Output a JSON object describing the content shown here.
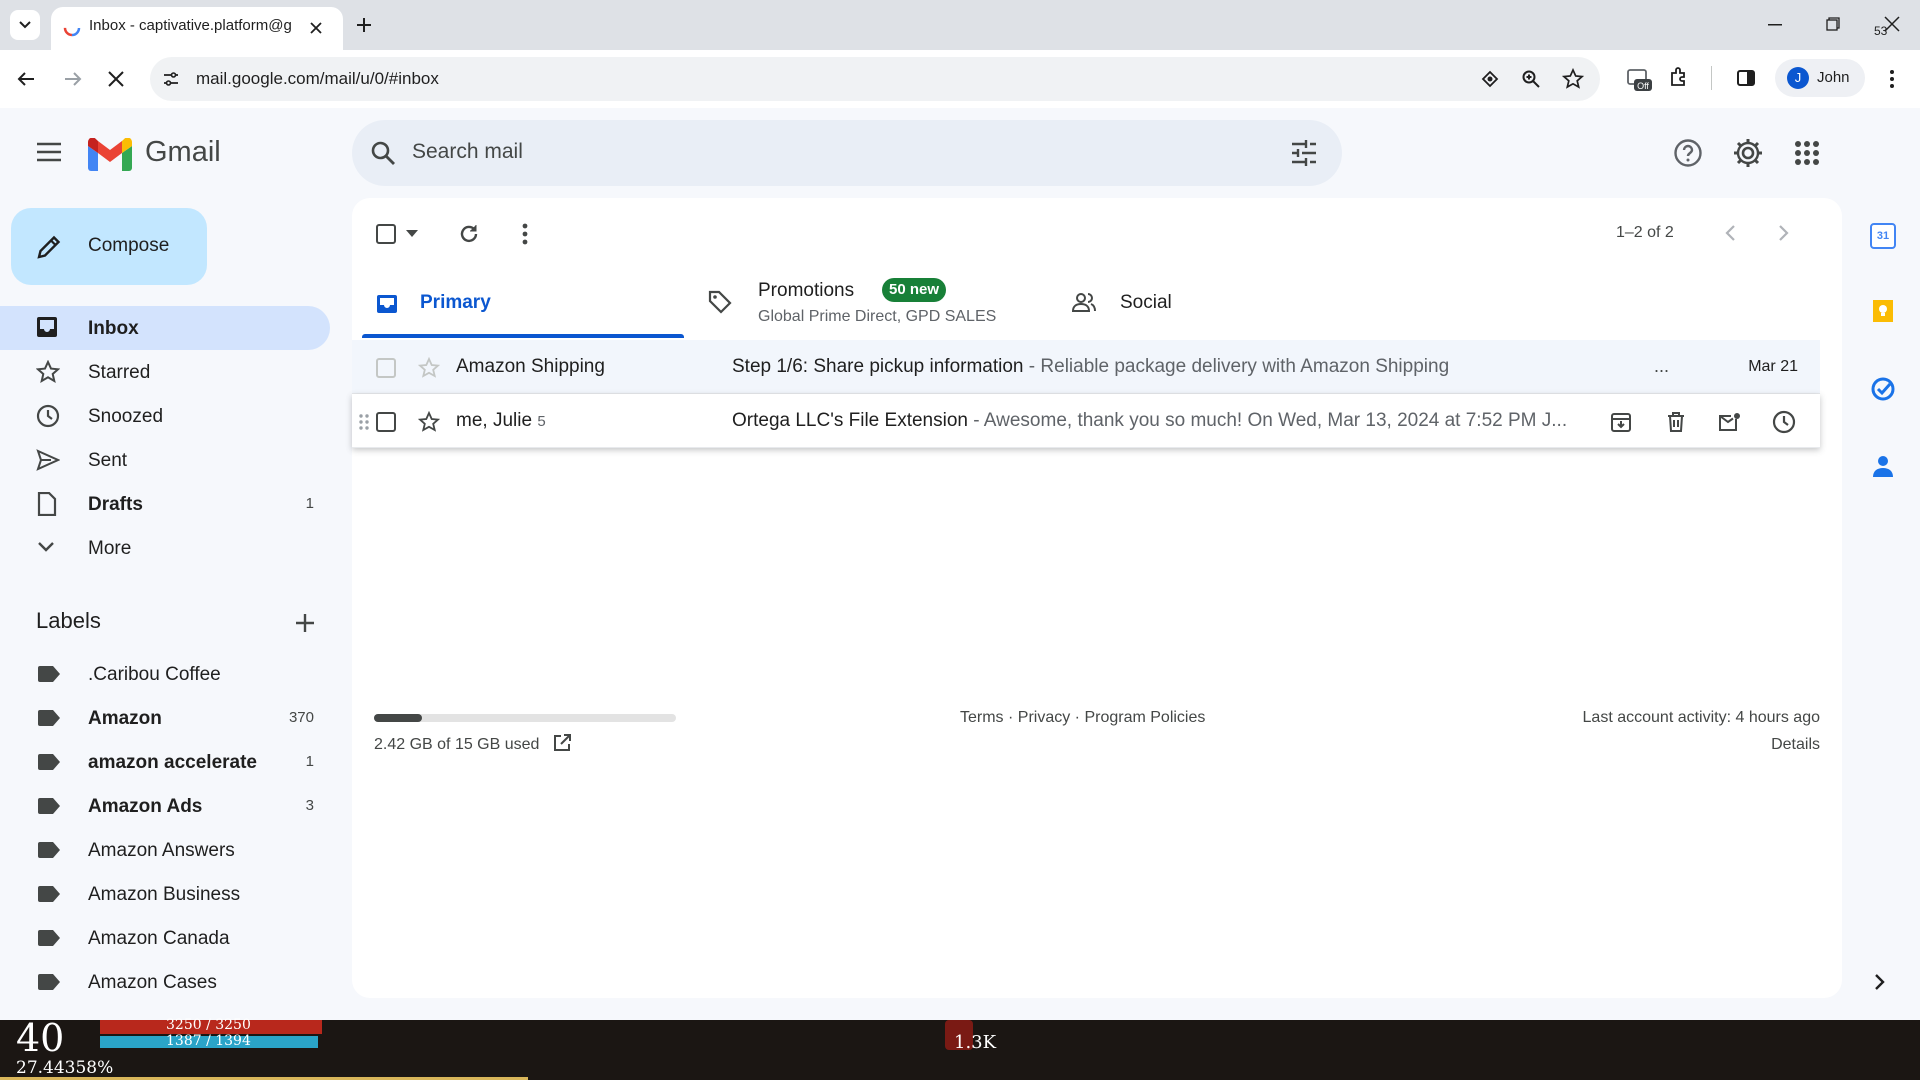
{
  "browser": {
    "tab_title": "Inbox - captivative.platform@g",
    "url": "mail.google.com/mail/u/0/#inbox",
    "profile_name": "John",
    "profile_initial": "J",
    "corner_badge": "53"
  },
  "gmail": {
    "logo_text": "Gmail",
    "search_placeholder": "Search mail",
    "avatar_initial": "J",
    "compose_label": "Compose",
    "nav": [
      {
        "label": "Inbox",
        "count": ""
      },
      {
        "label": "Starred",
        "count": ""
      },
      {
        "label": "Snoozed",
        "count": ""
      },
      {
        "label": "Sent",
        "count": ""
      },
      {
        "label": "Drafts",
        "count": "1"
      },
      {
        "label": "More",
        "count": ""
      }
    ],
    "labels_heading": "Labels",
    "labels": [
      {
        "label": ".Caribou Coffee",
        "count": ""
      },
      {
        "label": "Amazon",
        "count": "370"
      },
      {
        "label": "amazon accelerate",
        "count": "1"
      },
      {
        "label": "Amazon Ads",
        "count": "3"
      },
      {
        "label": "Amazon Answers",
        "count": ""
      },
      {
        "label": "Amazon Business",
        "count": ""
      },
      {
        "label": "Amazon Canada",
        "count": ""
      },
      {
        "label": "Amazon Cases",
        "count": ""
      }
    ],
    "pagination": "1–2 of 2",
    "tabs": {
      "primary": "Primary",
      "promotions": "Promotions",
      "promotions_badge": "50 new",
      "promotions_sub": "Global Prime Direct, GPD SALES",
      "social": "Social"
    },
    "emails": [
      {
        "sender": "Amazon Shipping",
        "count": "",
        "subject": "Step 1/6: Share pickup information",
        "snippet": " - Reliable package delivery with Amazon Shipping",
        "ellipsis": "...",
        "date": "Mar 21"
      },
      {
        "sender": "me, Julie",
        "count": "5",
        "subject": "Ortega LLC's File Extension",
        "snippet": " - Awesome, thank you so much! On Wed, Mar 13, 2024 at 7:52 PM J...",
        "ellipsis": "",
        "date": ""
      }
    ],
    "footer": {
      "storage": "2.42 GB of 15 GB used",
      "storage_fraction": 0.16,
      "links": "Terms · Privacy · Program Policies",
      "activity": "Last account activity: 4 hours ago",
      "details": "Details"
    }
  },
  "game_overlay": {
    "level": "40",
    "percent": "27.44358%",
    "hp": "3250 / 3250",
    "mp": "1387 / 1394",
    "center": "1.3K"
  },
  "colors": {
    "accent_blue": "#0b57d0",
    "compose_bg": "#c2e7ff",
    "active_nav": "#d3e3fd",
    "badge_green": "#188038"
  }
}
